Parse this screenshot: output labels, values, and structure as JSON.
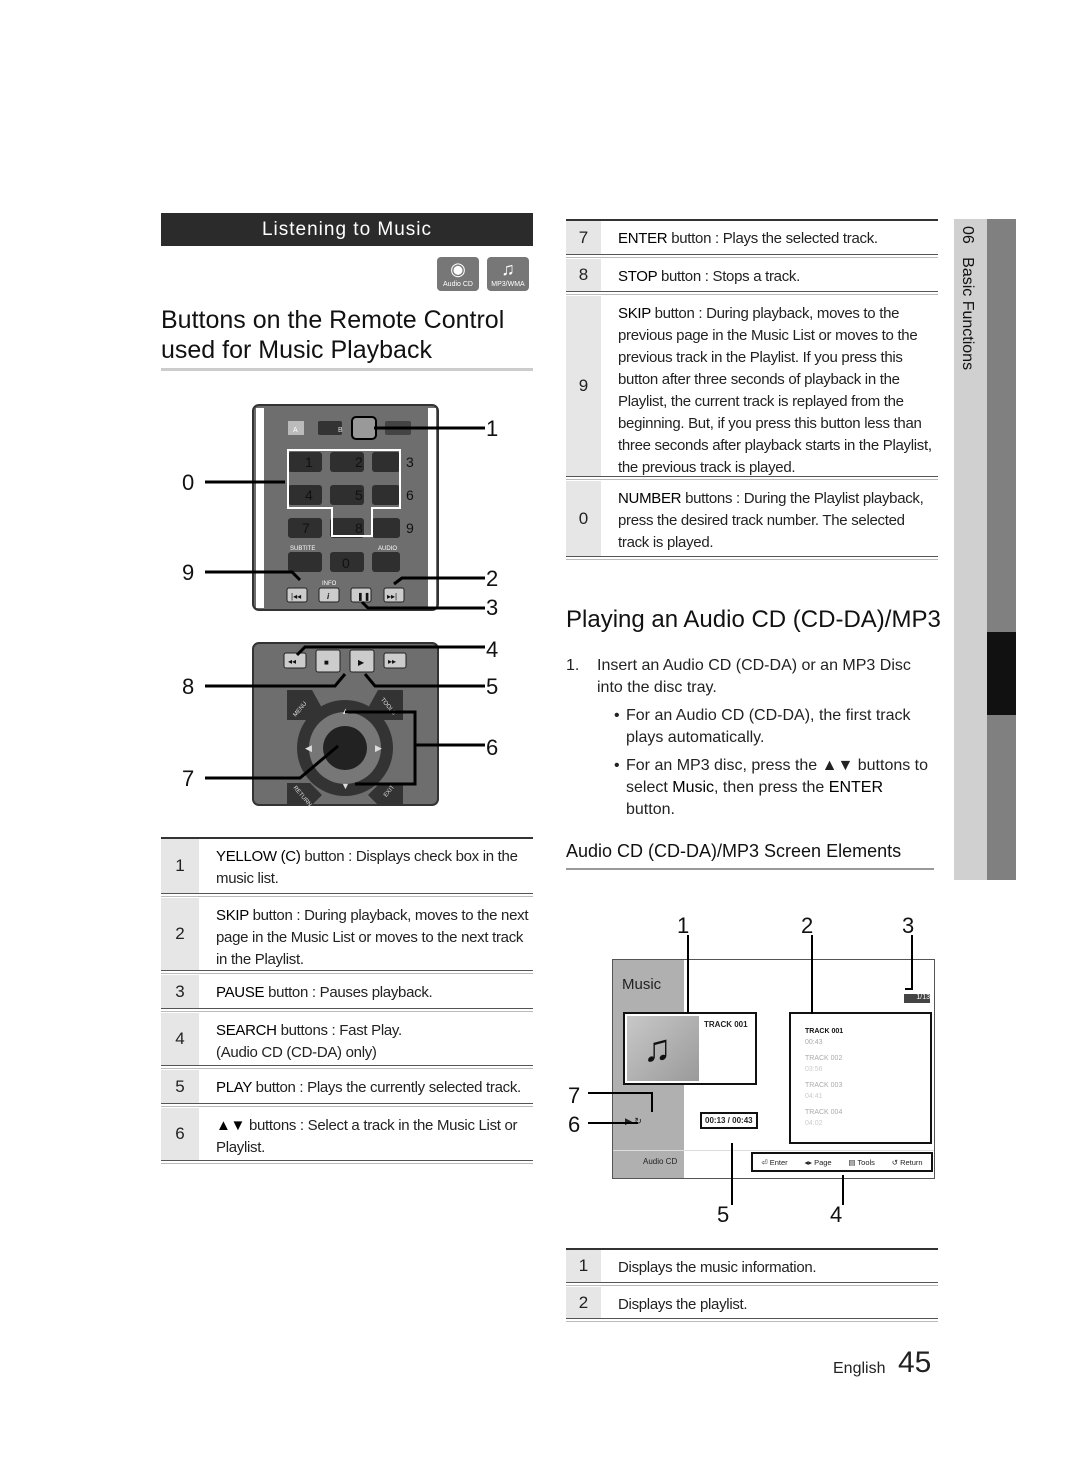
{
  "section_banner": "Listening to Music",
  "format_icons": [
    {
      "icon": "audio-cd-icon",
      "label": "Audio CD"
    },
    {
      "icon": "music-note-icon",
      "label": "MP3/WMA"
    }
  ],
  "left_title": "Buttons on the Remote Control used for Music Playback",
  "remote": {
    "callouts": [
      "0",
      "9",
      "8",
      "7",
      "1",
      "2",
      "3",
      "4",
      "5",
      "6"
    ],
    "keys": {
      "a": "A",
      "b": "B",
      "subtitle": "SUBTITE",
      "audio": "AUDIO",
      "info": "INFO",
      "menu": "MENU",
      "tools": "TOOLS",
      "return": "RETURN",
      "exit": "EXIT",
      "digits": [
        "1",
        "2",
        "3",
        "4",
        "5",
        "6",
        "7",
        "8",
        "9",
        "0"
      ]
    }
  },
  "left_table": [
    {
      "num": "1",
      "key": "YELLOW (C)",
      "text": " button : Displays check box in the music list."
    },
    {
      "num": "2",
      "key": "SKIP",
      "text": " button : During playback, moves to the next page in the Music List or moves to the next track in the Playlist."
    },
    {
      "num": "3",
      "key": "PAUSE",
      "text": " button : Pauses playback."
    },
    {
      "num": "4",
      "key": "SEARCH",
      "text": " buttons : Fast Play. (Audio CD (CD-DA) only)"
    },
    {
      "num": "5",
      "key": "PLAY",
      "text": " button : Plays the currently selected track."
    },
    {
      "num": "6",
      "key": "▲▼",
      "text": " buttons : Select a track in the Music List or Playlist."
    }
  ],
  "right_table": [
    {
      "num": "7",
      "key": "ENTER",
      "text": " button : Plays the selected track."
    },
    {
      "num": "8",
      "key": "STOP",
      "text": " button : Stops a track."
    },
    {
      "num": "9",
      "key": "SKIP",
      "text": " button : During playback, moves to the previous page in the Music List or moves to the previous track in the Playlist. If you press this button after three seconds of playback in the Playlist, the current track is replayed from the beginning. But, if you press this button less than three seconds after playback starts in the Playlist, the previous track is played."
    },
    {
      "num": "0",
      "key": "NUMBER",
      "text": " buttons : During the Playlist playback, press the desired track number. The selected track is played."
    }
  ],
  "right_title": "Playing an Audio CD (CD-DA)/MP3",
  "steps": {
    "n": "1.",
    "text": "Insert an Audio CD (CD-DA) or an MP3 Disc into the disc tray.",
    "bullet1": "For an Audio CD (CD-DA), the first track plays automatically.",
    "bullet2_a": "For an MP3 disc, press the ▲▼ buttons to select ",
    "bullet2_b": "Music",
    "bullet2_c": ", then press the ",
    "bullet2_d": "ENTER",
    "bullet2_e": " button."
  },
  "screen_title": "Audio CD (CD-DA)/MP3 Screen Elements",
  "screen": {
    "callouts": [
      "1",
      "2",
      "3",
      "7",
      "6",
      "5",
      "4"
    ],
    "header": "Music",
    "page_counter": "1/13",
    "now_playing": "TRACK 001",
    "time": "00:13 / 00:43",
    "source": "Audio CD",
    "playlist": [
      {
        "title": "TRACK 001",
        "time": "00:43"
      },
      {
        "title": "TRACK 002",
        "time": "03:56"
      },
      {
        "title": "TRACK 003",
        "time": "04:41"
      },
      {
        "title": "TRACK 004",
        "time": "04:02"
      }
    ],
    "nav": [
      "Enter",
      "Page",
      "Tools",
      "Return"
    ]
  },
  "bottom_table": [
    {
      "num": "1",
      "text": "Displays the music information."
    },
    {
      "num": "2",
      "text": "Displays the playlist."
    }
  ],
  "side_tab": {
    "chapter": "06",
    "label": "Basic Functions"
  },
  "footer": {
    "lang": "English",
    "page": "45"
  }
}
